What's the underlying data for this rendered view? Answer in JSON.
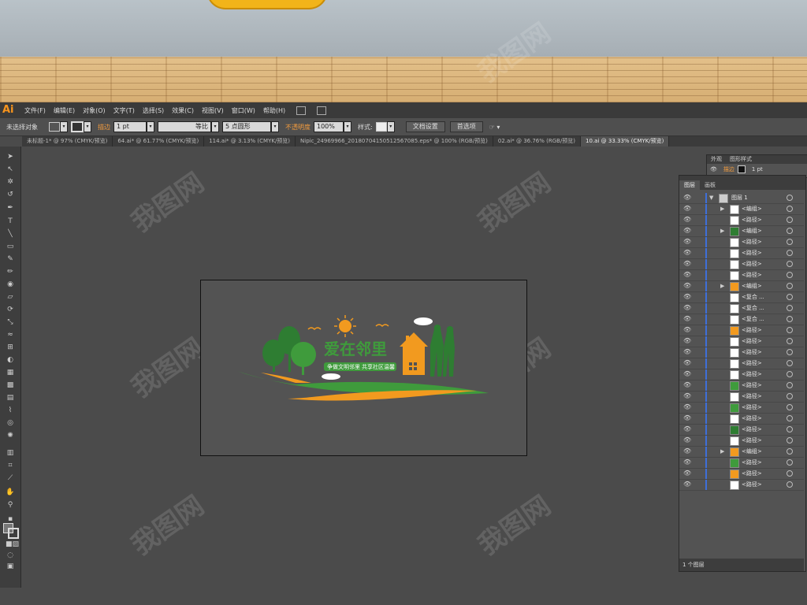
{
  "menubar": {
    "logo": "Ai",
    "items": [
      "文件(F)",
      "编辑(E)",
      "对象(O)",
      "文字(T)",
      "选择(S)",
      "效果(C)",
      "视图(V)",
      "窗口(W)",
      "帮助(H)"
    ]
  },
  "control_bar": {
    "selection_label": "未选择对象",
    "stroke_label": "描边",
    "stroke_weight": "1 pt",
    "profile_label": "等比",
    "brush_label": "5 点圆形",
    "opacity_label": "不透明度",
    "opacity_value": "100%",
    "style_label": "样式:",
    "doc_setup_button": "文档设置",
    "preferences_button": "首选项"
  },
  "tabs": [
    "未标题-1* @ 97% (CMYK/预览)",
    "64.ai* @ 61.77% (CMYK/预览)",
    "114.ai* @ 3.13% (CMYK/预览)",
    "Nipic_24969966_20180704150512567085.eps* @ 100% (RGB/预览)",
    "02.ai* @ 36.76% (RGB/预览)",
    "10.ai @ 33.33% (CMYK/预览)"
  ],
  "appearance_panel": {
    "tabs": [
      "外观",
      "图形样式"
    ],
    "stroke_label": "描边",
    "stroke_value": "1 pt"
  },
  "layers_panel": {
    "tabs": [
      "图层",
      "画板"
    ],
    "rows": [
      {
        "name": "图层 1",
        "expander": "▼",
        "thumb": "layer"
      },
      {
        "name": "<编组>",
        "expander": "▶",
        "thumb": "white"
      },
      {
        "name": "<路径>",
        "expander": "",
        "thumb": "line-green"
      },
      {
        "name": "<编组>",
        "expander": "▶",
        "thumb": "figure"
      },
      {
        "name": "<路径>",
        "expander": "",
        "thumb": "line-orange"
      },
      {
        "name": "<路径>",
        "expander": "",
        "thumb": "line-green"
      },
      {
        "name": "<路径>",
        "expander": "",
        "thumb": "line-green"
      },
      {
        "name": "<路径>",
        "expander": "",
        "thumb": "line-green"
      },
      {
        "name": "<编组>",
        "expander": "▶",
        "thumb": "sun"
      },
      {
        "name": "<复合 ...",
        "expander": "",
        "thumb": "line-green"
      },
      {
        "name": "<复合 ...",
        "expander": "",
        "thumb": "white"
      },
      {
        "name": "<复合 ...",
        "expander": "",
        "thumb": "white"
      },
      {
        "name": "<路径>",
        "expander": "",
        "thumb": "house"
      },
      {
        "name": "<路径>",
        "expander": "",
        "thumb": "white"
      },
      {
        "name": "<路径>",
        "expander": "",
        "thumb": "white"
      },
      {
        "name": "<路径>",
        "expander": "",
        "thumb": "line-orange"
      },
      {
        "name": "<路径>",
        "expander": "",
        "thumb": "line-orange"
      },
      {
        "name": "<路径>",
        "expander": "",
        "thumb": "tree"
      },
      {
        "name": "<路径>",
        "expander": "",
        "thumb": "white"
      },
      {
        "name": "<路径>",
        "expander": "",
        "thumb": "tree"
      },
      {
        "name": "<路径>",
        "expander": "",
        "thumb": "trunk"
      },
      {
        "name": "<路径>",
        "expander": "",
        "thumb": "tree-dark"
      },
      {
        "name": "<路径>",
        "expander": "",
        "thumb": "trunk"
      },
      {
        "name": "<编组>",
        "expander": "▶",
        "thumb": "house"
      },
      {
        "name": "<路径>",
        "expander": "",
        "thumb": "tree"
      },
      {
        "name": "<路径>",
        "expander": "",
        "thumb": "orange"
      },
      {
        "name": "<路径>",
        "expander": "",
        "thumb": "line-dark"
      }
    ],
    "footer": "1 个图层"
  },
  "artwork": {
    "title": "爱在邻里",
    "banner_text": "争做文明邻里 共享社区温馨",
    "colors": {
      "green": "#3f9b3c",
      "dark_green": "#2e7d32",
      "orange": "#f29a1f",
      "white": "#ffffff"
    }
  },
  "watermark": "我图网"
}
